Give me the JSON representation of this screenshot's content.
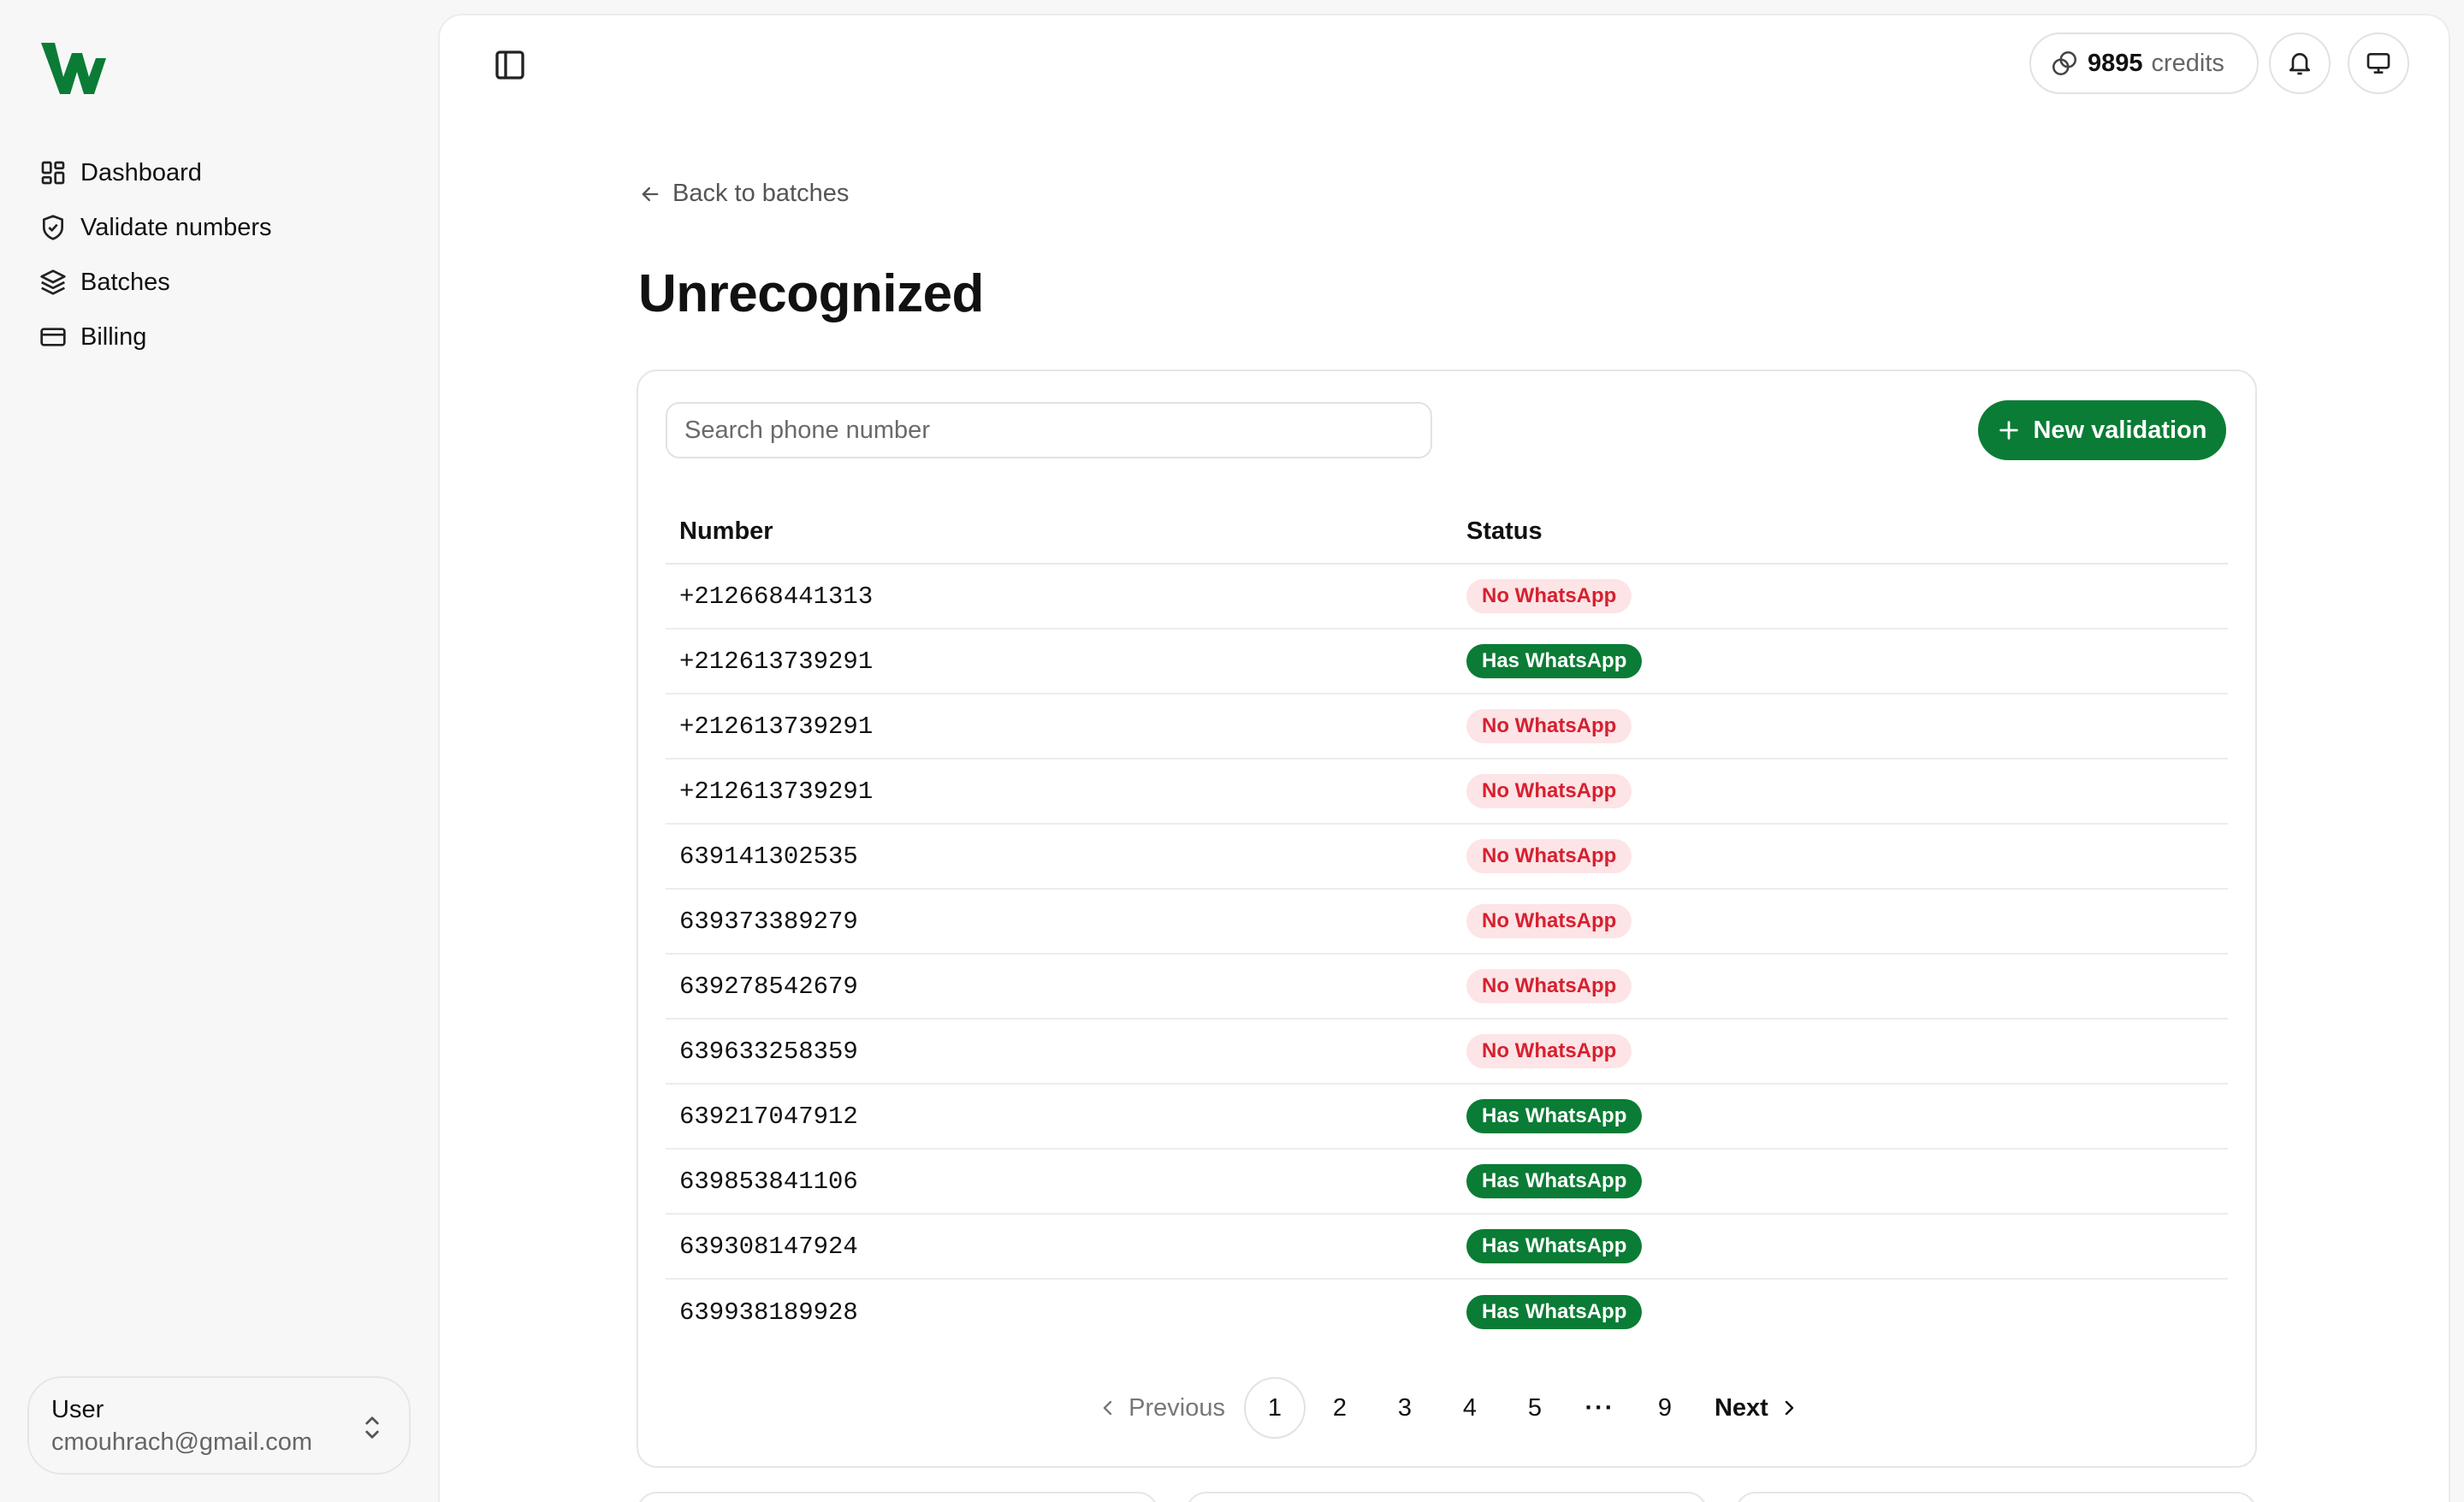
{
  "sidebar": {
    "logo_alt": "W",
    "items": [
      {
        "label": "Dashboard",
        "icon": "dashboard-icon"
      },
      {
        "label": "Validate numbers",
        "icon": "shield-check-icon"
      },
      {
        "label": "Batches",
        "icon": "layers-icon"
      },
      {
        "label": "Billing",
        "icon": "credit-card-icon"
      }
    ],
    "user": {
      "name": "User",
      "email": "cmouhrach@gmail.com"
    }
  },
  "header": {
    "credits_value": "9895",
    "credits_word": "credits"
  },
  "main": {
    "back_label": "Back to batches",
    "title": "Unrecognized",
    "search_placeholder": "Search phone number",
    "new_button_label": "New validation",
    "columns": {
      "number": "Number",
      "status": "Status"
    },
    "rows": [
      {
        "number": "+212668441313",
        "status": "No WhatsApp",
        "has": false
      },
      {
        "number": "+212613739291",
        "status": "Has WhatsApp",
        "has": true
      },
      {
        "number": "+212613739291",
        "status": "No WhatsApp",
        "has": false
      },
      {
        "number": "+212613739291",
        "status": "No WhatsApp",
        "has": false
      },
      {
        "number": "639141302535",
        "status": "No WhatsApp",
        "has": false
      },
      {
        "number": "639373389279",
        "status": "No WhatsApp",
        "has": false
      },
      {
        "number": "639278542679",
        "status": "No WhatsApp",
        "has": false
      },
      {
        "number": "639633258359",
        "status": "No WhatsApp",
        "has": false
      },
      {
        "number": "639217047912",
        "status": "Has WhatsApp",
        "has": true
      },
      {
        "number": "639853841106",
        "status": "Has WhatsApp",
        "has": true
      },
      {
        "number": "639308147924",
        "status": "Has WhatsApp",
        "has": true
      },
      {
        "number": "639938189928",
        "status": "Has WhatsApp",
        "has": true
      }
    ],
    "pagination": {
      "previous": "Previous",
      "next": "Next",
      "pages": [
        "1",
        "2",
        "3",
        "4",
        "5"
      ],
      "ellipsis": "···",
      "last": "9",
      "current": "1"
    }
  },
  "colors": {
    "brand_green": "#0a7c35",
    "no_badge_bg": "#fde4e6",
    "no_badge_text": "#d6202f"
  }
}
